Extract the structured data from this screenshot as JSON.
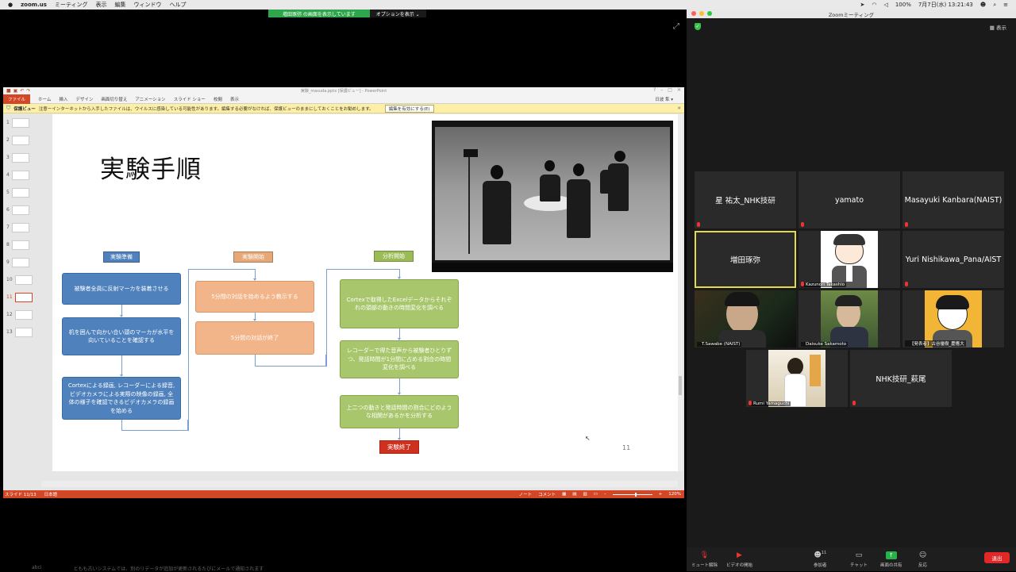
{
  "menubar": {
    "app": "zoom.us",
    "items": [
      "ミーティング",
      "表示",
      "編集",
      "ウィンドウ",
      "ヘルプ"
    ],
    "battery": "100%",
    "datetime": "7月7日(水) 13:21:43"
  },
  "share_banner": {
    "message": "増田琢弥 の画面を表示しています",
    "options": "オプションを表示 ⌄"
  },
  "powerpoint": {
    "title": "実験_masuda.pptx [保護ビュー] - PowerPoint",
    "tabs": [
      "ファイル",
      "ホーム",
      "挿入",
      "デザイン",
      "画面切り替え",
      "アニメーション",
      "スライド ショー",
      "校閲",
      "表示"
    ],
    "user": "日波 隼 ▾",
    "warning_label": "保護ビュー",
    "warning_text": "注意ーインターネットから入手したファイルは、ウイルスに感染している可能性があります。編集する必要がなければ、保護ビューのままにしておくことをお勧めします。",
    "enable_editing": "編集を有効にする(E)",
    "thumb_numbers": [
      "1",
      "2",
      "3",
      "4",
      "5",
      "6",
      "7",
      "8",
      "9",
      "10",
      "11",
      "12",
      "13"
    ],
    "selected_slide": 11,
    "status_left": "スライド 11/13",
    "status_lang": "日本語",
    "status_note": "ノート",
    "status_comment": "コメント",
    "zoom": "120%"
  },
  "slide": {
    "title": "実験手順",
    "page_number": "11",
    "col1_tag": "実験準備",
    "col2_tag": "実験開始",
    "col3_tag": "分析開始",
    "col1_boxes": [
      "被験者全員に反射マーカを装着させる",
      "机を囲んで向かい合い頭のマーカが水平を向いていることを確認する",
      "Cortexによる録画, レコーダーによる録音, ビデオカメラによる実際の映像の録画, 全体の様子を確認できるビデオカメラの録画を始める"
    ],
    "col2_boxes": [
      "5分間の対話を始めるよう教示する",
      "5分間の対話が終了"
    ],
    "col3_boxes": [
      "Cortexで取得したExcelデータからそれぞれの頭部の動きの時間変化を調べる",
      "レコーダーで得た音声から被験者ひとりずつ、発話時間が1分間に占める割合の時間変化を調べる",
      "上二つの動きと発話時間の割合にどのような相関があるかを分析する"
    ],
    "end_box": "実験終了"
  },
  "zoom": {
    "window_title": "Zoomミーティング",
    "view_button": "表示",
    "participants": [
      {
        "name": "星 祐太_NHK技研",
        "has_video": false,
        "active": false
      },
      {
        "name": "yamato",
        "has_video": false,
        "active": false
      },
      {
        "name": "Masayuki Kanbara(NAIST)",
        "has_video": false,
        "active": false
      },
      {
        "name": "増田琢弥",
        "has_video": false,
        "active": true
      },
      {
        "name": "Kazunori Takashio",
        "has_video": true,
        "active": false
      },
      {
        "name": "Yuri Nishikawa_Pana/AIST",
        "has_video": false,
        "active": false
      },
      {
        "name": "T.Sawabe (NAIST)",
        "has_video": true,
        "active": false
      },
      {
        "name": "Daisuke Sakamoto",
        "has_video": true,
        "active": false
      },
      {
        "name": "【発表者】古谷優樹_慶應大",
        "has_video": true,
        "active": false
      },
      {
        "name": "Rumi Yamaguchi",
        "has_video": true,
        "active": false
      },
      {
        "name": "NHK技研_萩尾",
        "has_video": false,
        "active": false
      }
    ],
    "toolbar": {
      "mute": "ミュート解除",
      "video": "ビデオの開始",
      "participants": "参加者",
      "participants_count": "11",
      "chat": "チャット",
      "share": "画面の共有",
      "reactions": "反応",
      "end": "退出"
    }
  },
  "bottom_ghost": {
    "left": "abci",
    "text": "ともも古いシステムでは、別のリデータが追加が更新されるたびにメールで通知されます"
  }
}
